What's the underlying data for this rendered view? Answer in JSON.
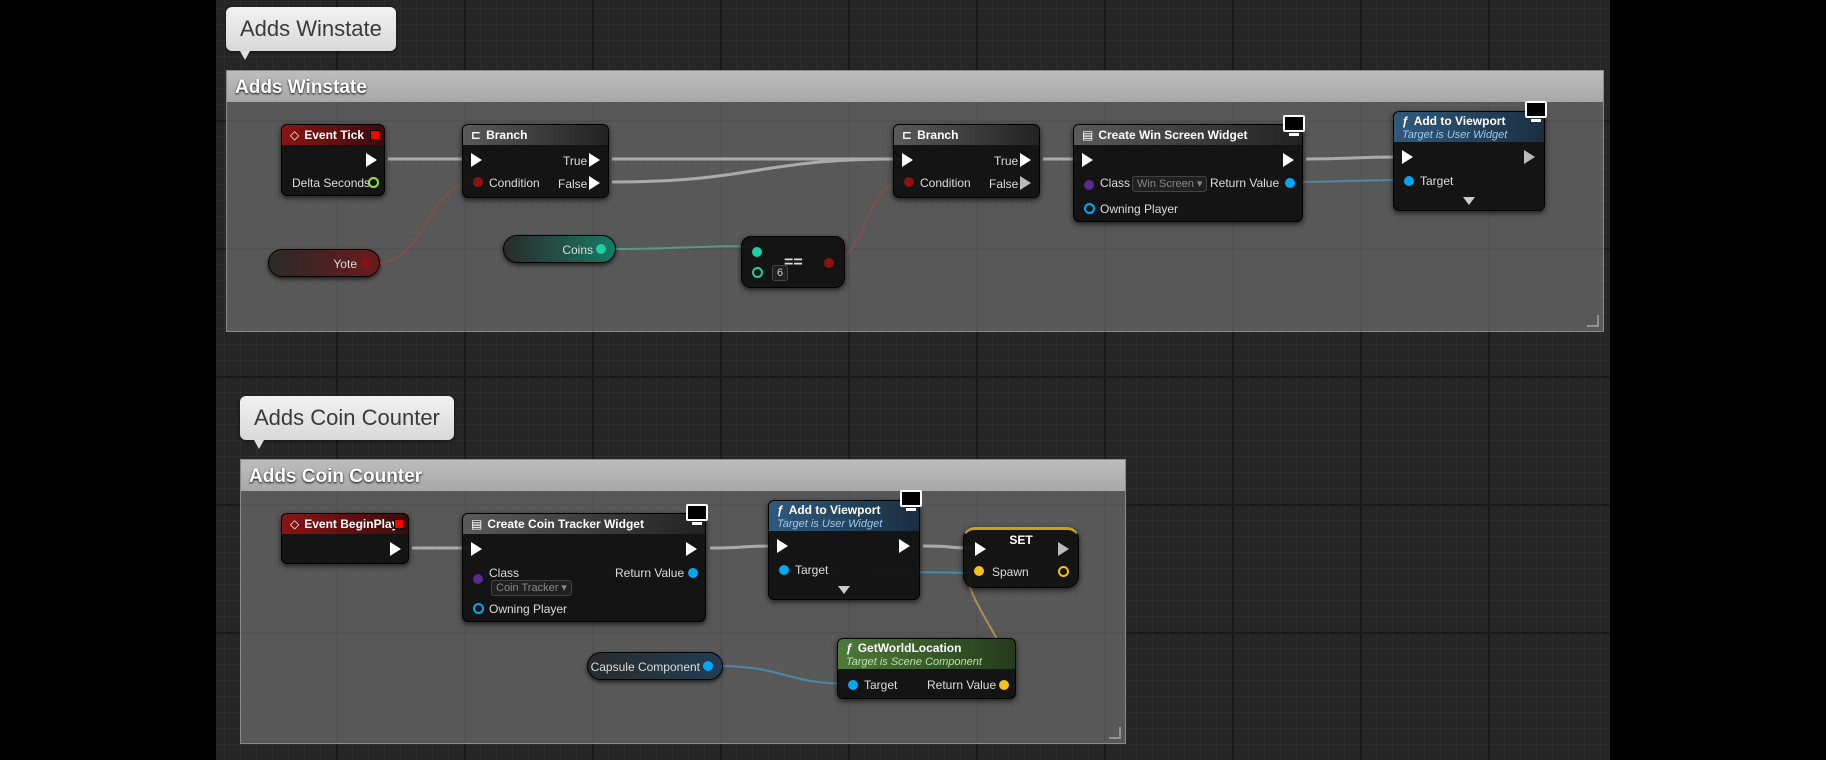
{
  "comments": {
    "winstate": {
      "bubble": "Adds Winstate",
      "header": "Adds Winstate"
    },
    "coin_counter": {
      "bubble": "Adds Coin Counter",
      "header": "Adds Coin Counter"
    }
  },
  "colors": {
    "exec": "#ffffff",
    "boolean": "#8a1212",
    "integer": "#1fcfa0",
    "object": "#00a8f4",
    "class": "#5a2a90",
    "vector": "#f3c11a",
    "float": "#9ae04a"
  },
  "winstate": {
    "event_tick": {
      "title": "Event Tick",
      "delta": "Delta Seconds"
    },
    "branch1": {
      "title": "Branch",
      "true": "True",
      "false": "False",
      "condition": "Condition"
    },
    "branch2": {
      "title": "Branch",
      "true": "True",
      "false": "False",
      "condition": "Condition"
    },
    "create_widget": {
      "title": "Create Win Screen Widget",
      "class": "Class",
      "class_value": "Win Screen",
      "return": "Return Value",
      "owning": "Owning Player"
    },
    "add_viewport": {
      "title": "Add to Viewport",
      "subtitle": "Target is User Widget",
      "target": "Target"
    },
    "yote": "Yote",
    "coins": "Coins",
    "equal": {
      "op": "==",
      "value": "6"
    }
  },
  "coin_counter": {
    "begin_play": {
      "title": "Event BeginPlay"
    },
    "create_widget": {
      "title": "Create Coin Tracker Widget",
      "class": "Class",
      "class_value": "Coin Tracker",
      "return": "Return Value",
      "owning": "Owning Player"
    },
    "add_viewport": {
      "title": "Add to Viewport",
      "subtitle": "Target is User Widget",
      "target": "Target"
    },
    "set": {
      "title": "SET",
      "spawn": "Spawn"
    },
    "get_world_location": {
      "title": "GetWorldLocation",
      "subtitle": "Target is Scene Component",
      "target": "Target",
      "return": "Return Value"
    },
    "capsule": "Capsule Component"
  }
}
